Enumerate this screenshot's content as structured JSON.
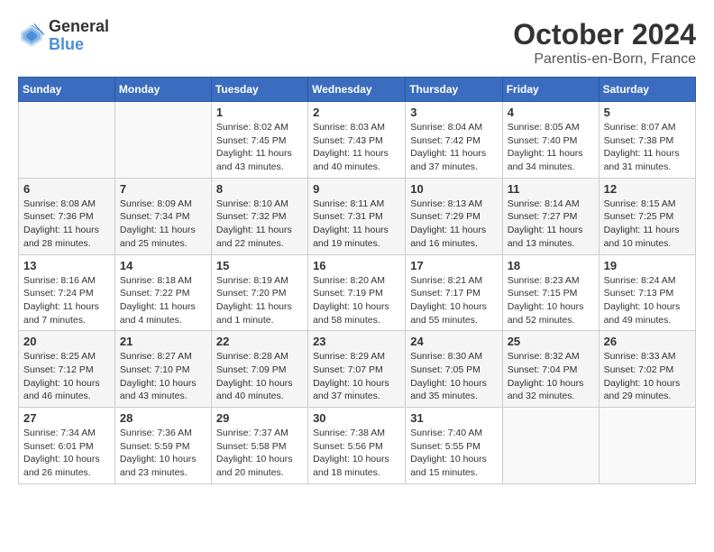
{
  "logo": {
    "text_general": "General",
    "text_blue": "Blue"
  },
  "title": "October 2024",
  "location": "Parentis-en-Born, France",
  "headers": [
    "Sunday",
    "Monday",
    "Tuesday",
    "Wednesday",
    "Thursday",
    "Friday",
    "Saturday"
  ],
  "weeks": [
    [
      {
        "day": "",
        "info": ""
      },
      {
        "day": "",
        "info": ""
      },
      {
        "day": "1",
        "info": "Sunrise: 8:02 AM\nSunset: 7:45 PM\nDaylight: 11 hours and 43 minutes."
      },
      {
        "day": "2",
        "info": "Sunrise: 8:03 AM\nSunset: 7:43 PM\nDaylight: 11 hours and 40 minutes."
      },
      {
        "day": "3",
        "info": "Sunrise: 8:04 AM\nSunset: 7:42 PM\nDaylight: 11 hours and 37 minutes."
      },
      {
        "day": "4",
        "info": "Sunrise: 8:05 AM\nSunset: 7:40 PM\nDaylight: 11 hours and 34 minutes."
      },
      {
        "day": "5",
        "info": "Sunrise: 8:07 AM\nSunset: 7:38 PM\nDaylight: 11 hours and 31 minutes."
      }
    ],
    [
      {
        "day": "6",
        "info": "Sunrise: 8:08 AM\nSunset: 7:36 PM\nDaylight: 11 hours and 28 minutes."
      },
      {
        "day": "7",
        "info": "Sunrise: 8:09 AM\nSunset: 7:34 PM\nDaylight: 11 hours and 25 minutes."
      },
      {
        "day": "8",
        "info": "Sunrise: 8:10 AM\nSunset: 7:32 PM\nDaylight: 11 hours and 22 minutes."
      },
      {
        "day": "9",
        "info": "Sunrise: 8:11 AM\nSunset: 7:31 PM\nDaylight: 11 hours and 19 minutes."
      },
      {
        "day": "10",
        "info": "Sunrise: 8:13 AM\nSunset: 7:29 PM\nDaylight: 11 hours and 16 minutes."
      },
      {
        "day": "11",
        "info": "Sunrise: 8:14 AM\nSunset: 7:27 PM\nDaylight: 11 hours and 13 minutes."
      },
      {
        "day": "12",
        "info": "Sunrise: 8:15 AM\nSunset: 7:25 PM\nDaylight: 11 hours and 10 minutes."
      }
    ],
    [
      {
        "day": "13",
        "info": "Sunrise: 8:16 AM\nSunset: 7:24 PM\nDaylight: 11 hours and 7 minutes."
      },
      {
        "day": "14",
        "info": "Sunrise: 8:18 AM\nSunset: 7:22 PM\nDaylight: 11 hours and 4 minutes."
      },
      {
        "day": "15",
        "info": "Sunrise: 8:19 AM\nSunset: 7:20 PM\nDaylight: 11 hours and 1 minute."
      },
      {
        "day": "16",
        "info": "Sunrise: 8:20 AM\nSunset: 7:19 PM\nDaylight: 10 hours and 58 minutes."
      },
      {
        "day": "17",
        "info": "Sunrise: 8:21 AM\nSunset: 7:17 PM\nDaylight: 10 hours and 55 minutes."
      },
      {
        "day": "18",
        "info": "Sunrise: 8:23 AM\nSunset: 7:15 PM\nDaylight: 10 hours and 52 minutes."
      },
      {
        "day": "19",
        "info": "Sunrise: 8:24 AM\nSunset: 7:13 PM\nDaylight: 10 hours and 49 minutes."
      }
    ],
    [
      {
        "day": "20",
        "info": "Sunrise: 8:25 AM\nSunset: 7:12 PM\nDaylight: 10 hours and 46 minutes."
      },
      {
        "day": "21",
        "info": "Sunrise: 8:27 AM\nSunset: 7:10 PM\nDaylight: 10 hours and 43 minutes."
      },
      {
        "day": "22",
        "info": "Sunrise: 8:28 AM\nSunset: 7:09 PM\nDaylight: 10 hours and 40 minutes."
      },
      {
        "day": "23",
        "info": "Sunrise: 8:29 AM\nSunset: 7:07 PM\nDaylight: 10 hours and 37 minutes."
      },
      {
        "day": "24",
        "info": "Sunrise: 8:30 AM\nSunset: 7:05 PM\nDaylight: 10 hours and 35 minutes."
      },
      {
        "day": "25",
        "info": "Sunrise: 8:32 AM\nSunset: 7:04 PM\nDaylight: 10 hours and 32 minutes."
      },
      {
        "day": "26",
        "info": "Sunrise: 8:33 AM\nSunset: 7:02 PM\nDaylight: 10 hours and 29 minutes."
      }
    ],
    [
      {
        "day": "27",
        "info": "Sunrise: 7:34 AM\nSunset: 6:01 PM\nDaylight: 10 hours and 26 minutes."
      },
      {
        "day": "28",
        "info": "Sunrise: 7:36 AM\nSunset: 5:59 PM\nDaylight: 10 hours and 23 minutes."
      },
      {
        "day": "29",
        "info": "Sunrise: 7:37 AM\nSunset: 5:58 PM\nDaylight: 10 hours and 20 minutes."
      },
      {
        "day": "30",
        "info": "Sunrise: 7:38 AM\nSunset: 5:56 PM\nDaylight: 10 hours and 18 minutes."
      },
      {
        "day": "31",
        "info": "Sunrise: 7:40 AM\nSunset: 5:55 PM\nDaylight: 10 hours and 15 minutes."
      },
      {
        "day": "",
        "info": ""
      },
      {
        "day": "",
        "info": ""
      }
    ]
  ]
}
